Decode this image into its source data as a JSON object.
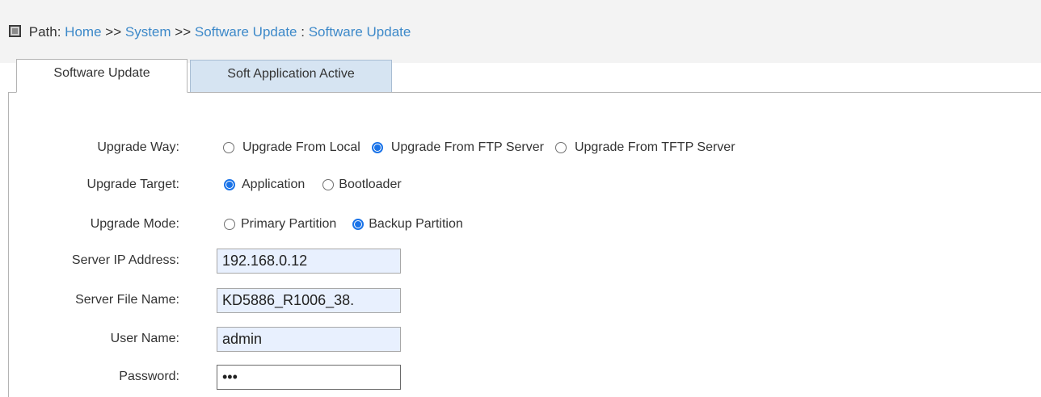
{
  "path": {
    "label": "Path:",
    "crumbs": [
      "Home",
      "System",
      "Software Update",
      "Software Update"
    ],
    "sep1": ">>",
    "sep2": ">>",
    "sep3": ":"
  },
  "tabs": [
    {
      "label": "Software Update",
      "active": true
    },
    {
      "label": "Soft Application Active",
      "active": false
    }
  ],
  "form": {
    "upgrade_way": {
      "label": "Upgrade Way:",
      "options": [
        "Upgrade From Local",
        "Upgrade From FTP Server",
        "Upgrade From TFTP Server"
      ],
      "selected": "Upgrade From FTP Server"
    },
    "upgrade_target": {
      "label": "Upgrade Target:",
      "options": [
        "Application",
        "Bootloader"
      ],
      "selected": "Application"
    },
    "upgrade_mode": {
      "label": "Upgrade Mode:",
      "options": [
        "Primary Partition",
        "Backup Partition"
      ],
      "selected": "Backup Partition"
    },
    "server_ip": {
      "label": "Server IP Address:",
      "value": "192.168.0.12"
    },
    "server_file": {
      "label": "Server File Name:",
      "value": "KD5886_R1006_38."
    },
    "user_name": {
      "label": "User Name:",
      "value": "admin"
    },
    "password": {
      "label": "Password:",
      "value": "•••"
    }
  },
  "colors": {
    "link": "#3d89c9",
    "radio_accent": "#1a73e8",
    "autofill_bg": "#e8f0fe",
    "inactive_tab_bg": "#d6e4f2"
  }
}
